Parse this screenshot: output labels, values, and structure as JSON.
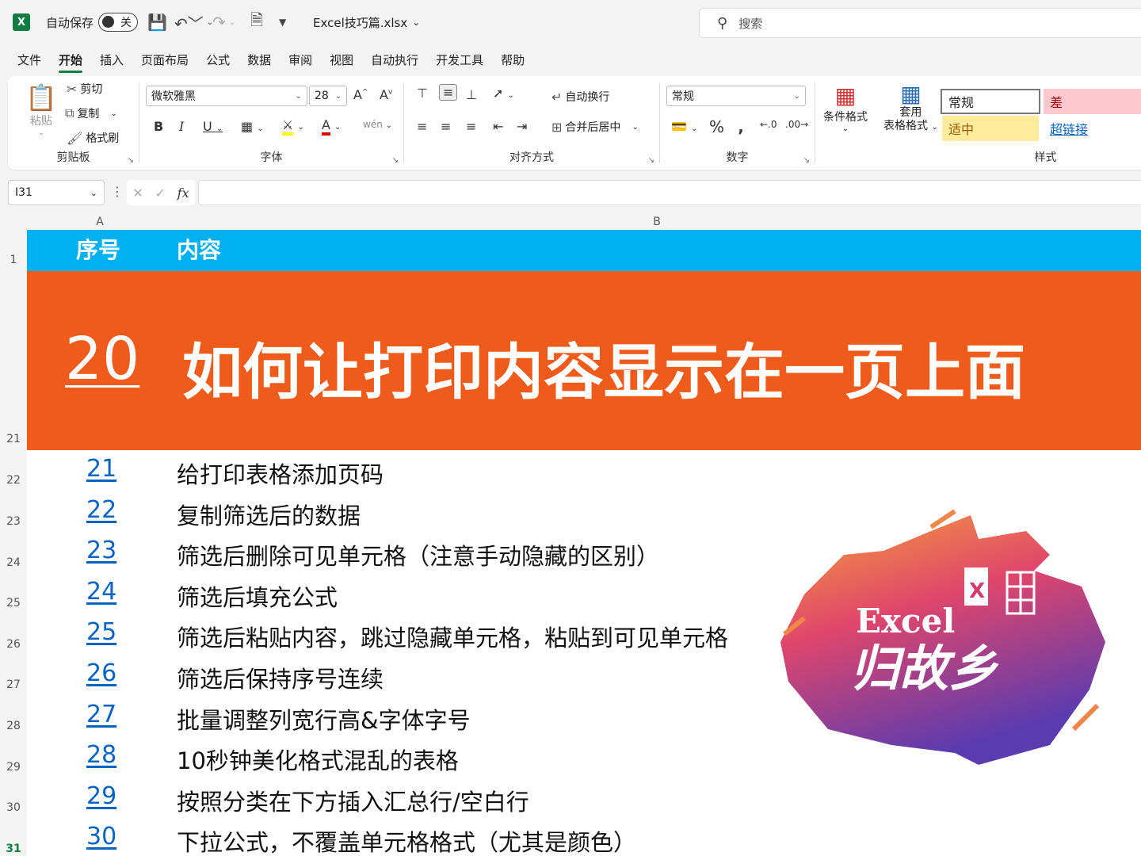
{
  "titlebar": {
    "autosave_label": "自动保存",
    "toggle_text": "关",
    "filename": "Excel技巧篇.xlsx",
    "search_placeholder": "搜索"
  },
  "menu": [
    "文件",
    "开始",
    "插入",
    "页面布局",
    "公式",
    "数据",
    "审阅",
    "视图",
    "自动执行",
    "开发工具",
    "帮助"
  ],
  "ribbon": {
    "clipboard": {
      "paste": "粘贴",
      "cut": "剪切",
      "copy": "复制",
      "format_painter": "格式刷",
      "label": "剪贴板"
    },
    "font": {
      "family": "微软雅黑",
      "size": "28",
      "label": "字体"
    },
    "alignment": {
      "wrap": "自动换行",
      "merge": "合并后居中",
      "label": "对齐方式"
    },
    "number": {
      "format": "常规",
      "label": "数字"
    },
    "styles": {
      "conditional": "条件格式",
      "table_line1": "套用",
      "table_line2": "表格格式",
      "normal": "常规",
      "bad": "差",
      "neutral": "适中",
      "hyperlink": "超链接",
      "label": "样式"
    }
  },
  "formula_bar": {
    "name_box": "I31",
    "fx": "fx"
  },
  "columns": [
    "A",
    "B"
  ],
  "rows": [
    "1",
    "21",
    "22",
    "23",
    "24",
    "25",
    "26",
    "27",
    "28",
    "29",
    "30",
    "31"
  ],
  "header": {
    "col_a": "序号",
    "col_b": "内容"
  },
  "banner": {
    "num": "20",
    "title": "如何让打印内容显示在一页上面"
  },
  "items": [
    {
      "num": "21",
      "text": "给打印表格添加页码"
    },
    {
      "num": "22",
      "text": "复制筛选后的数据"
    },
    {
      "num": "23",
      "text": "筛选后删除可见单元格（注意手动隐藏的区别）"
    },
    {
      "num": "24",
      "text": "筛选后填充公式"
    },
    {
      "num": "25",
      "text": "筛选后粘贴内容，跳过隐藏单元格，粘贴到可见单元格"
    },
    {
      "num": "26",
      "text": "筛选后保持序号连续"
    },
    {
      "num": "27",
      "text": "批量调整列宽行高&字体字号"
    },
    {
      "num": "28",
      "text": "10秒钟美化格式混乱的表格"
    },
    {
      "num": "29",
      "text": "按照分类在下方插入汇总行/空白行"
    },
    {
      "num": "30",
      "text": "下拉公式，不覆盖单元格格式（尤其是颜色）"
    }
  ],
  "logo": {
    "line1": "Excel",
    "line2": "归故乡"
  },
  "colors": {
    "header_blue": "#00b0f0",
    "banner_orange": "#ef5b1b",
    "link_blue": "#0563c1",
    "excel_green": "#107c41"
  }
}
